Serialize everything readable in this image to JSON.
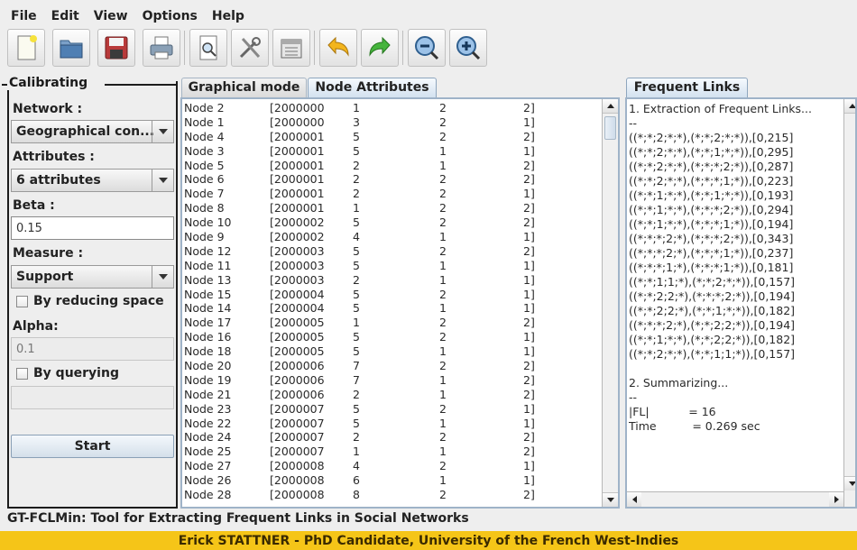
{
  "menu": [
    "File",
    "Edit",
    "View",
    "Options",
    "Help"
  ],
  "toolbar": {
    "icons": [
      "new-file-icon",
      "open-folder-icon",
      "save-icon",
      "print-icon",
      "print-preview-icon",
      "settings-tools-icon",
      "calculator-icon",
      "undo-icon",
      "redo-icon",
      "zoom-out-icon",
      "zoom-in-icon"
    ]
  },
  "calibrating": {
    "title": "Calibrating",
    "network_label": "Network :",
    "network_value": "Geographical con...",
    "attributes_label": "Attributes :",
    "attributes_value": "6 attributes",
    "beta_label": "Beta :",
    "beta_value": "0.15",
    "measure_label": "Measure :",
    "measure_value": "Support",
    "reducing_label": "By reducing space",
    "alpha_label": "Alpha:",
    "alpha_value": "0.1",
    "querying_label": "By querying",
    "query_value": "",
    "start_label": "Start"
  },
  "tabs": {
    "graphical": "Graphical mode",
    "node_attributes": "Node Attributes",
    "frequent_links": "Frequent Links"
  },
  "node_rows": [
    [
      "Node 2",
      "[2000000",
      "1",
      "2",
      "2]"
    ],
    [
      "Node 1",
      "[2000000",
      "3",
      "2",
      "1]"
    ],
    [
      "Node 4",
      "[2000001",
      "5",
      "2",
      "2]"
    ],
    [
      "Node 3",
      "[2000001",
      "5",
      "1",
      "1]"
    ],
    [
      "Node 5",
      "[2000001",
      "2",
      "1",
      "2]"
    ],
    [
      "Node 6",
      "[2000001",
      "2",
      "2",
      "2]"
    ],
    [
      "Node 7",
      "[2000001",
      "2",
      "2",
      "1]"
    ],
    [
      "Node 8",
      "[2000001",
      "1",
      "2",
      "2]"
    ],
    [
      "Node 10",
      "[2000002",
      "5",
      "2",
      "2]"
    ],
    [
      "Node 9",
      "[2000002",
      "4",
      "1",
      "1]"
    ],
    [
      "Node 12",
      "[2000003",
      "5",
      "2",
      "2]"
    ],
    [
      "Node 11",
      "[2000003",
      "5",
      "1",
      "1]"
    ],
    [
      "Node 13",
      "[2000003",
      "2",
      "1",
      "1]"
    ],
    [
      "Node 15",
      "[2000004",
      "5",
      "2",
      "1]"
    ],
    [
      "Node 14",
      "[2000004",
      "5",
      "1",
      "1]"
    ],
    [
      "Node 17",
      "[2000005",
      "1",
      "2",
      "2]"
    ],
    [
      "Node 16",
      "[2000005",
      "5",
      "2",
      "1]"
    ],
    [
      "Node 18",
      "[2000005",
      "5",
      "1",
      "1]"
    ],
    [
      "Node 20",
      "[2000006",
      "7",
      "2",
      "2]"
    ],
    [
      "Node 19",
      "[2000006",
      "7",
      "1",
      "2]"
    ],
    [
      "Node 21",
      "[2000006",
      "2",
      "1",
      "2]"
    ],
    [
      "Node 23",
      "[2000007",
      "5",
      "2",
      "1]"
    ],
    [
      "Node 22",
      "[2000007",
      "5",
      "1",
      "1]"
    ],
    [
      "Node 24",
      "[2000007",
      "2",
      "2",
      "2]"
    ],
    [
      "Node 25",
      "[2000007",
      "1",
      "1",
      "2]"
    ],
    [
      "Node 27",
      "[2000008",
      "4",
      "2",
      "1]"
    ],
    [
      "Node 26",
      "[2000008",
      "6",
      "1",
      "1]"
    ],
    [
      "Node 28",
      "[2000008",
      "8",
      "2",
      "2]"
    ]
  ],
  "frequent_links_text": "1. Extraction of Frequent Links...\n--\n((*;*;2;*;*),(*;*;2;*;*)),[0,215]\n((*;*;2;*;*),(*;*;1;*;*)),[0,295]\n((*;*;2;*;*),(*;*;*;2;*)),[0,287]\n((*;*;2;*;*),(*;*;*;1;*)),[0,223]\n((*;*;1;*;*),(*;*;1;*;*)),[0,193]\n((*;*;1;*;*),(*;*;*;2;*)),[0,294]\n((*;*;1;*;*),(*;*;*;1;*)),[0,194]\n((*;*;*;2;*),(*;*;*;2;*)),[0,343]\n((*;*;*;2;*),(*;*;*;1;*)),[0,237]\n((*;*;*;1;*),(*;*;*;1;*)),[0,181]\n((*;*;1;1;*),(*;*;2;*;*)),[0,157]\n((*;*;2;2;*),(*;*;*;2;*)),[0,194]\n((*;*;2;2;*),(*;*;1;*;*)),[0,182]\n((*;*;*;2;*),(*;*;2;2;*)),[0,194]\n((*;*;1;*;*),(*;*;2;2;*)),[0,182]\n((*;*;2;*;*),(*;*;1;1;*)),[0,157]\n\n2. Summarizing...\n--\n|FL|           = 16\nTime          = 0.269 sec",
  "status_text": "GT-FCLMin: Tool for Extracting Frequent Links in Social Networks",
  "footer_text": "Erick STATTNER - PhD Candidate, University of the French West-Indies"
}
